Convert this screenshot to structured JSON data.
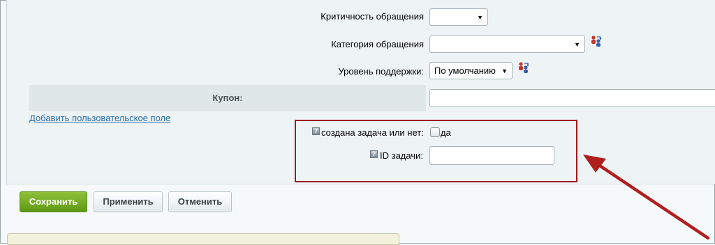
{
  "fields": {
    "criticality_label": "Критичность обращения",
    "criticality_value": "",
    "category_label": "Категория обращения",
    "category_value": "",
    "support_level_label": "Уровень поддержки:",
    "support_level_value": "По умолчанию",
    "coupon_label": "Купон:",
    "coupon_value": ""
  },
  "add_field_link": "Добавить пользовательское поле",
  "custom_fields": {
    "task_created_label": "создана задача или нет:",
    "task_created_option": "да",
    "task_created_checked": false,
    "task_id_label": "ID задачи:",
    "task_id_value": "",
    "help_icon_glyph": "?"
  },
  "buttons": {
    "save": "Сохранить",
    "apply": "Применить",
    "cancel": "Отменить"
  },
  "icons": {
    "dropdown_arrow": "▼",
    "swap": "users-swap-icon"
  },
  "colors": {
    "highlight_box": "#9a1b1b",
    "annotation_arrow": "#b01e1e",
    "save_button": "#6ea822"
  }
}
